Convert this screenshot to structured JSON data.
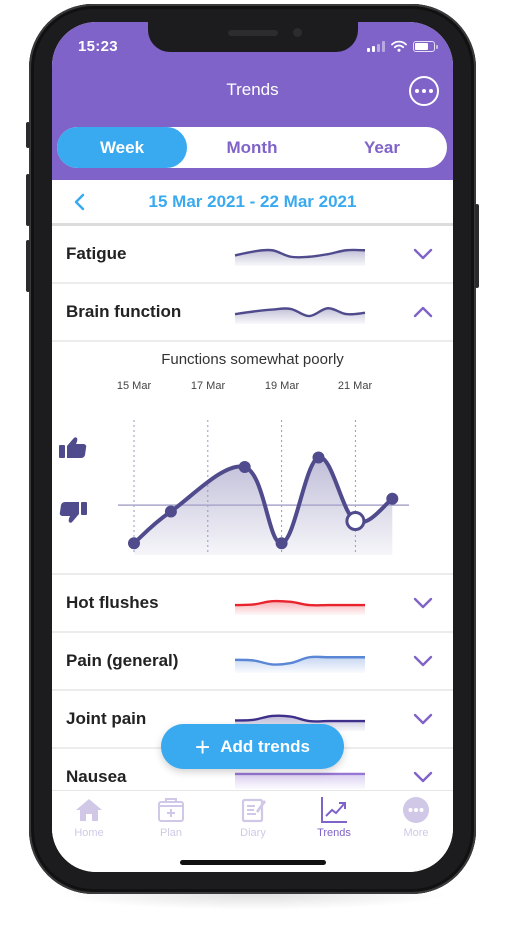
{
  "status_bar": {
    "time": "15:23"
  },
  "header": {
    "title": "Trends",
    "more_icon": "more-dots-icon"
  },
  "segmented": {
    "options": [
      "Week",
      "Month",
      "Year"
    ],
    "selected": "Week"
  },
  "date_range": {
    "label": "15 Mar 2021 - 22 Mar 2021",
    "prev_icon": "chevron-left-icon"
  },
  "colors": {
    "header_purple": "#7f63c8",
    "accent_blue": "#3aaaf0",
    "chart_line": "#4f4b8c",
    "hot_flushes": "#e8252e",
    "pain_general": "#5a86d6",
    "joint_pain": "#3f2f8a",
    "nausea": "#9677d4"
  },
  "trends": [
    {
      "label": "Fatigue",
      "expanded": false,
      "color": "#4f4b8c",
      "spark": [
        0.35,
        0.65,
        0.75,
        0.25,
        0.25,
        0.45,
        0.75,
        0.75
      ]
    },
    {
      "label": "Brain function",
      "expanded": true,
      "color": "#4f4b8c",
      "spark": [
        0.3,
        0.5,
        0.65,
        0.7,
        0.15,
        0.75,
        0.3,
        0.4
      ]
    },
    {
      "label": "Hot flushes",
      "expanded": false,
      "color": "#e8252e",
      "spark": [
        0.3,
        0.35,
        0.6,
        0.55,
        0.3,
        0.3,
        0.3,
        0.3
      ]
    },
    {
      "label": "Pain (general)",
      "expanded": false,
      "color": "#5a86d6",
      "spark": [
        0.55,
        0.5,
        0.2,
        0.3,
        0.75,
        0.75,
        0.75,
        0.75
      ]
    },
    {
      "label": "Joint pain",
      "expanded": false,
      "color": "#3f2f8a",
      "spark": [
        0.35,
        0.4,
        0.7,
        0.65,
        0.3,
        0.3,
        0.3,
        0.3
      ]
    },
    {
      "label": "Nausea",
      "expanded": false,
      "color": "#9677d4",
      "spark": [
        0.7,
        0.7,
        0.7,
        0.7,
        0.7,
        0.7,
        0.7,
        0.7
      ]
    }
  ],
  "brain_chart": {
    "caption": "Functions somewhat poorly",
    "x_labels": [
      "15 Mar",
      "17 Mar",
      "19 Mar",
      "21 Mar"
    ],
    "y_icons": [
      "thumbs-up-icon",
      "thumbs-down-icon"
    ],
    "chart_data": {
      "type": "area",
      "title": "Functions somewhat poorly",
      "x": [
        "15 Mar",
        "16 Mar",
        "17 Mar",
        "18 Mar",
        "19 Mar",
        "20 Mar",
        "21 Mar",
        "22 Mar"
      ],
      "values": [
        1.0,
        2.0,
        null,
        3.4,
        1.0,
        3.7,
        1.7,
        2.4
      ],
      "highlighted_point": "21 Mar",
      "reference_line": 2.2,
      "ylim": [
        0,
        4
      ],
      "grid": "vertical dotted at labeled dates"
    }
  },
  "add_button": {
    "label": "Add trends",
    "icon": "plus-icon"
  },
  "tabbar": {
    "items": [
      {
        "label": "Home",
        "icon": "home-icon",
        "active": false
      },
      {
        "label": "Plan",
        "icon": "medkit-icon",
        "active": false
      },
      {
        "label": "Diary",
        "icon": "diary-icon",
        "active": false
      },
      {
        "label": "Trends",
        "icon": "trends-chart-icon",
        "active": true
      },
      {
        "label": "More",
        "icon": "more-dots-icon",
        "active": false
      }
    ]
  }
}
